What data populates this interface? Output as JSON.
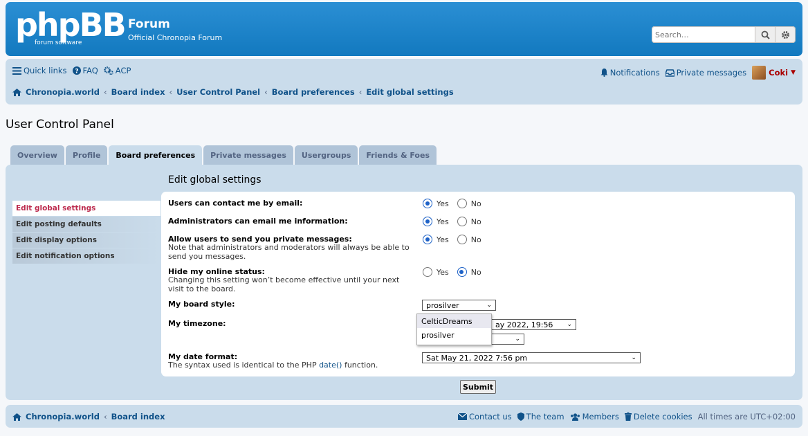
{
  "header": {
    "logo_text": "phpBB",
    "logo_sub": "forum software",
    "title": "Forum",
    "description": "Official Chronopia Forum",
    "search_placeholder": "Search…"
  },
  "nav": {
    "quick_links": "Quick links",
    "faq": "FAQ",
    "acp": "ACP",
    "notifications": "Notifications",
    "private_messages": "Private messages",
    "username": "Coki"
  },
  "breadcrumbs": [
    "Chronopia.world",
    "Board index",
    "User Control Panel",
    "Board preferences",
    "Edit global settings"
  ],
  "page_title": "User Control Panel",
  "tabs": [
    "Overview",
    "Profile",
    "Board preferences",
    "Private messages",
    "Usergroups",
    "Friends & Foes"
  ],
  "sidebar": [
    "Edit global settings",
    "Edit posting defaults",
    "Edit display options",
    "Edit notification options"
  ],
  "form": {
    "title": "Edit global settings",
    "yes": "Yes",
    "no": "No",
    "email_label": "Users can contact me by email:",
    "admin_email_label": "Administrators can email me information:",
    "pm_label": "Allow users to send you private messages:",
    "pm_note": "Note that administrators and moderators will always be able to send you messages.",
    "online_label": "Hide my online status:",
    "online_note": "Changing this setting won’t become effective until your next visit to the board.",
    "style_label": "My board style:",
    "style_value": "prosilver",
    "style_options": [
      "CelticDreams",
      "prosilver"
    ],
    "timezone_label": "My timezone:",
    "timezone_value": "ay 2022, 19:56",
    "dateformat_label": "My date format:",
    "dateformat_note_pre": "The syntax used is identical to the PHP ",
    "dateformat_note_link": "date()",
    "dateformat_note_post": " function.",
    "dateformat_value": "Sat May 21, 2022 7:56 pm",
    "submit": "Submit"
  },
  "footer": {
    "left": [
      "Chronopia.world",
      "Board index"
    ],
    "contact": "Contact us",
    "team": "The team",
    "members": "Members",
    "delete_cookies": "Delete cookies",
    "timezone": "All times are UTC+02:00"
  },
  "colors": {
    "brand": "#1e7fc4",
    "link": "#105289",
    "active_red": "#bc2a4d"
  }
}
